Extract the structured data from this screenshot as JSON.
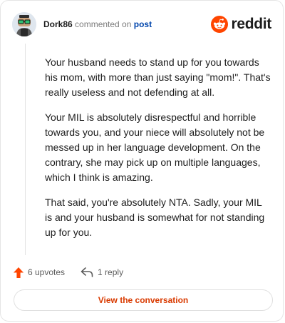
{
  "header": {
    "username": "Dork86",
    "action_text": "commented on",
    "post_link": "post",
    "brand": "reddit"
  },
  "comment": {
    "paragraphs": [
      "Your husband needs to stand up for you towards his mom, with more than just saying \"mom!\". That's really useless and not defending at all.",
      "Your MIL is absolutely disrespectful and horrible towards you, and your niece will absolutely not be messed up in her language development. On the contrary, she may pick up on multiple languages, which I think is amazing.",
      "That said, you're absolutely NTA. Sadly, your MIL is and your husband is somewhat for not standing up for you."
    ]
  },
  "actions": {
    "upvotes": "6 upvotes",
    "replies": "1 reply"
  },
  "cta": {
    "label": "View the conversation"
  },
  "colors": {
    "brand_orange": "#ff4500",
    "link_blue": "#0045ac",
    "cta_text": "#d93a00"
  },
  "icons": {
    "upvote": "upvote-arrow-icon",
    "reply": "reply-arrow-icon",
    "logo": "reddit-alien-icon"
  }
}
